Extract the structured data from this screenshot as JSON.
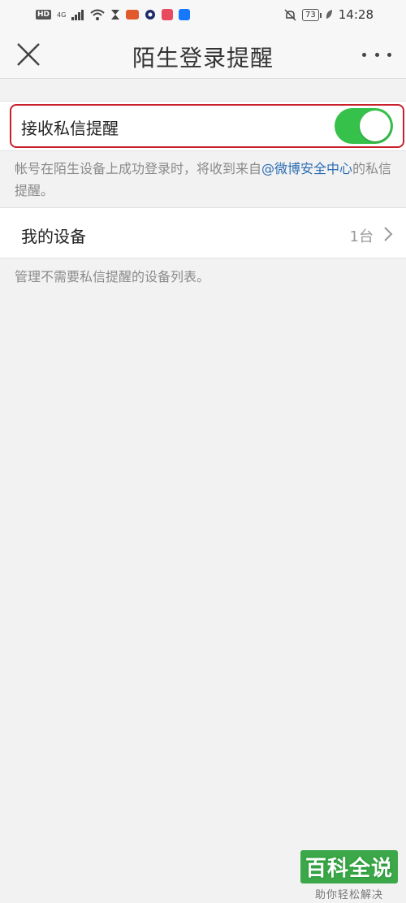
{
  "status_bar": {
    "hd_label": "HD",
    "network_label": "4G",
    "battery_level": "73",
    "time": "14:28"
  },
  "nav": {
    "title": "陌生登录提醒"
  },
  "settings": {
    "toggle_label": "接收私信提醒",
    "toggle_on": true,
    "toggle_description_before": "帐号在陌生设备上成功登录时，将收到来自",
    "toggle_description_link": "@微博安全中心",
    "toggle_description_after": "的私信提醒。",
    "devices_label": "我的设备",
    "devices_count": "1台",
    "devices_description": "管理不需要私信提醒的设备列表。"
  },
  "watermark": {
    "title": "百科全说",
    "subtitle": "助你轻松解决"
  },
  "colors": {
    "toggle_on": "#36c24a",
    "link": "#2b6cb4",
    "highlight": "#c8202a"
  }
}
